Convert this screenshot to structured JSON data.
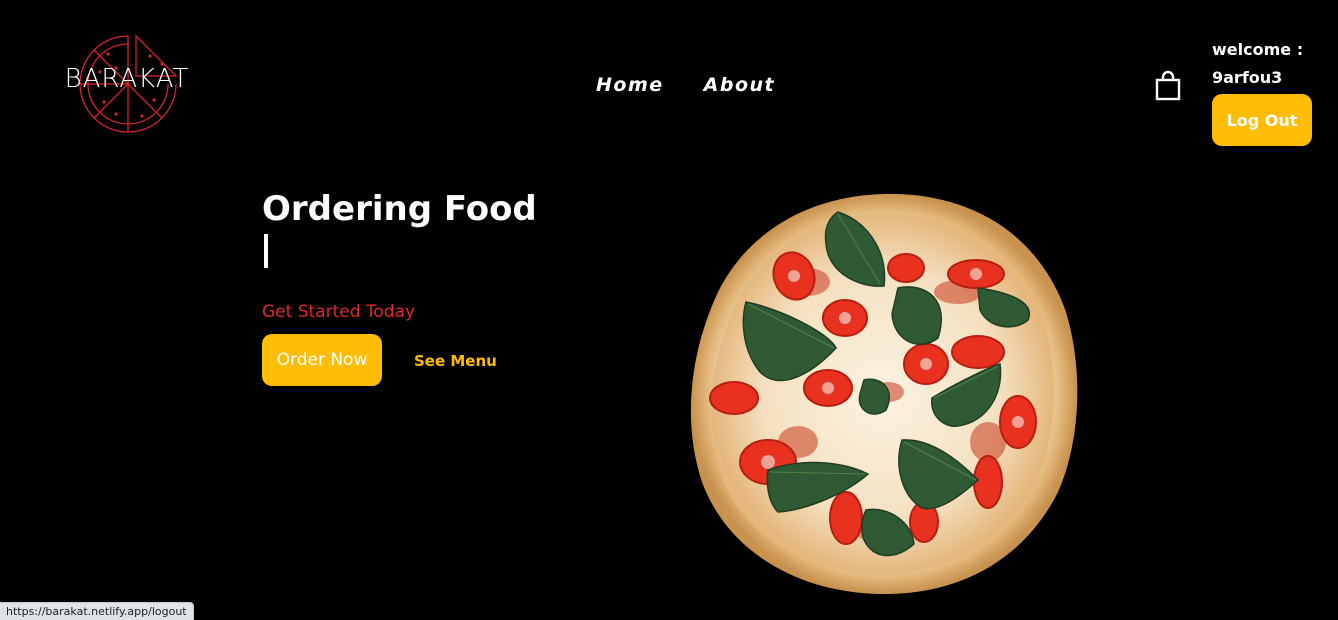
{
  "brand": {
    "name": "BARAKAT",
    "accent_color": "#e0262f"
  },
  "nav": {
    "items": [
      {
        "label": "Home"
      },
      {
        "label": "About"
      }
    ]
  },
  "header": {
    "cart_icon": "shopping-bag-icon",
    "welcome_label": "welcome :",
    "username": "9arfou3",
    "logout_label": "Log Out"
  },
  "hero": {
    "title": "Ordering Food",
    "subtitle": "Get Started Today",
    "order_button": "Order Now",
    "menu_link": "See Menu",
    "image": "pizza-image"
  },
  "colors": {
    "primary": "#ffbd06",
    "background": "#000000",
    "subtitle": "#e0262f"
  },
  "statusbar": {
    "url": "https://barakat.netlify.app/logout"
  }
}
